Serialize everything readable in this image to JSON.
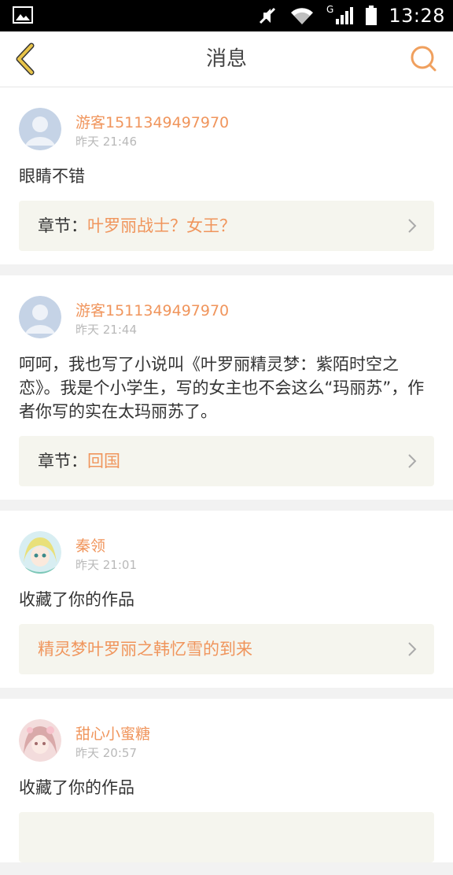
{
  "status_bar": {
    "time": "13:28",
    "network_label": "G"
  },
  "header": {
    "title": "消息"
  },
  "messages": [
    {
      "name": "游客1511349497970",
      "time": "昨天 21:46",
      "content": "眼睛不错",
      "chapter_key": "章节：",
      "chapter_value": "叶罗丽战士？女王？",
      "avatar": "default-avatar-icon"
    },
    {
      "name": "游客1511349497970",
      "time": "昨天 21:44",
      "content": "呵呵，我也写了小说叫《叶罗丽精灵梦：紫陌时空之恋》。我是个小学生，写的女主也不会这么“玛丽苏”，作者你写的实在太玛丽苏了。",
      "chapter_key": "章节：",
      "chapter_value": "回国",
      "avatar": "default-avatar-icon"
    },
    {
      "name": "秦领",
      "time": "昨天 21:01",
      "content": "收藏了你的作品",
      "chapter_key": "",
      "chapter_value": "精灵梦叶罗丽之韩忆雪的到来",
      "avatar": "anime-girl-avatar"
    },
    {
      "name": "甜心小蜜糖",
      "time": "昨天 20:57",
      "content": "收藏了你的作品",
      "chapter_key": "",
      "chapter_value": "",
      "avatar": "pink-anime-avatar"
    }
  ],
  "colors": {
    "accent": "#f0955c",
    "back_arrow": "#d8b53a"
  }
}
